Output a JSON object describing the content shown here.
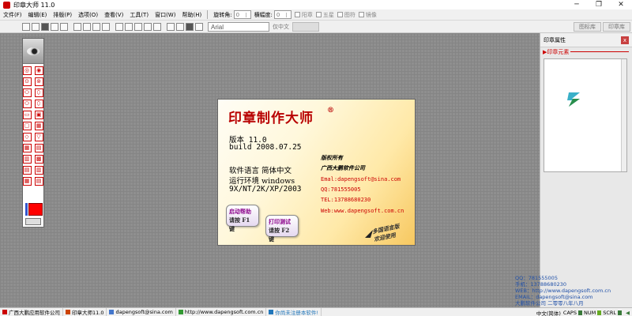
{
  "window": {
    "title": "印章大师 11.0",
    "minimize": "─",
    "maximize": "❐",
    "close": "✕"
  },
  "menu": [
    "文件(F)",
    "编辑(E)",
    "排版(P)",
    "选项(O)",
    "查看(V)",
    "工具(T)",
    "窗口(W)",
    "帮助(H)"
  ],
  "stamp_options": {
    "rotation_label": "旋转角:",
    "rotation_value": "0",
    "aspect_label": "横幅度:",
    "aspect_value": "0",
    "checkboxes": [
      "阳章",
      "五星",
      "图符",
      "镜像"
    ]
  },
  "top_tabs": [
    "图标库",
    "印章库"
  ],
  "toolbar": {
    "font": "Arial",
    "lang_label": "仅中文"
  },
  "splash": {
    "title": "印章制作大师",
    "reg_mark": "®",
    "version": "版本  11.0",
    "build": "build 2008.07.25",
    "software_lang": "软件语言   简体中文",
    "run_env": "运行环境   windows",
    "os_list": "9X/NT/2K/XP/2003",
    "copyright": "版权所有",
    "company": "广西大鹏软件公司",
    "email": "Emal:dapengsoft@sina.com",
    "qq": "QQ:781555005",
    "tel": "TEL:13788680230",
    "web": "Web:www.dapengsoft.com.cn",
    "help_btn": {
      "line1": "启动帮助",
      "line2": "请按 F1 键"
    },
    "print_btn": {
      "line1": "打印测试",
      "line2": "请按 F2 键"
    },
    "promo_line1": "多国语言版",
    "promo_line2": "欢迎使用"
  },
  "right_panel": {
    "title": "印章属性",
    "close": "x",
    "sub": "▶印章元素"
  },
  "contact_overlay": [
    "QQ：781555005",
    "手机：13788680230",
    "WEB：http://www.dapengsoft.com.cn",
    "EMAIL：dapengsoft@sina.com",
    "大鹏软件公司 二零零八年八月"
  ],
  "statusbar": {
    "items": [
      "广西大鹏应用软件公司",
      "印章大师11.0",
      "dapengsoft@sina.com",
      "http://www.dapengsoft.com.cn",
      "你尚未注册本软件!"
    ],
    "ime": "中文(简体)",
    "caps": "CAPS",
    "num": "NUM",
    "scrl": "SCRL"
  }
}
